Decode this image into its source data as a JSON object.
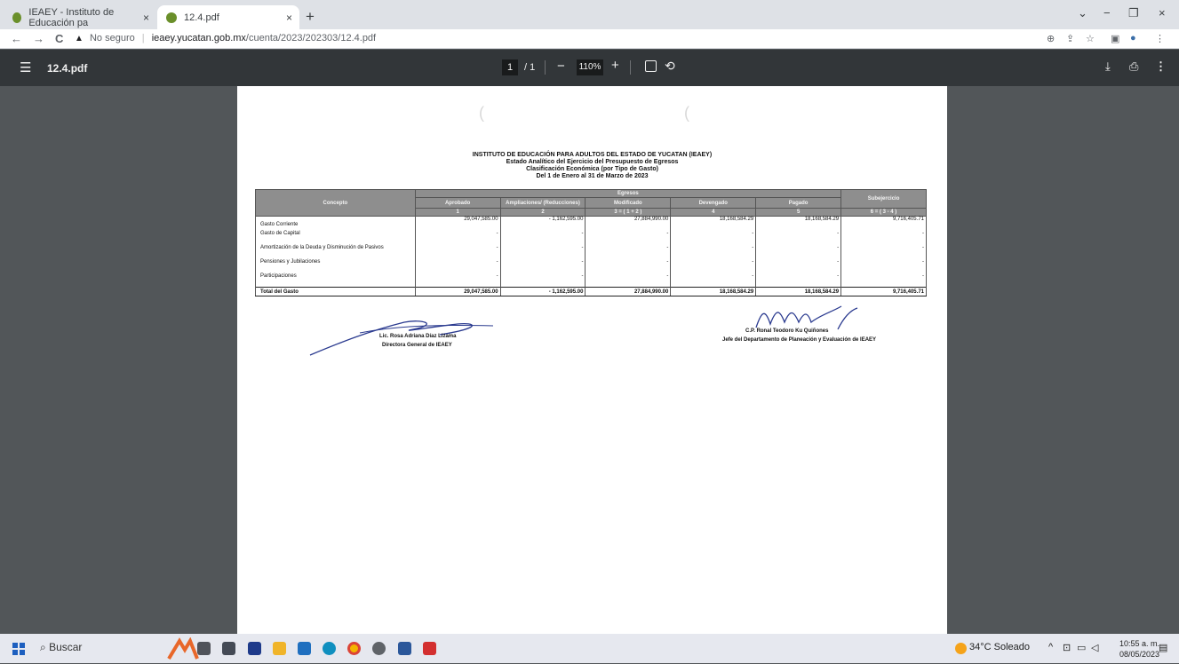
{
  "tabs": [
    {
      "title": "IEAEY - Instituto de Educación pa",
      "close": "×"
    },
    {
      "title": "12.4.pdf",
      "close": "×"
    }
  ],
  "new_tab": "+",
  "window_controls": {
    "minimize": "−",
    "restore": "❐",
    "close": "×",
    "dropdown": "⌄"
  },
  "address": {
    "back": "←",
    "forward": "→",
    "reload": "C",
    "warning": "▲",
    "security": "No seguro",
    "separator": "|",
    "domain": "ieaey.yucatan.gob.mx",
    "path": "/cuenta/2023/202303/12.4.pdf"
  },
  "address_icons": {
    "zoom": "⊕",
    "share": "⇪",
    "star": "☆",
    "sidebar": "▣",
    "profile": "●",
    "menu": "⋮"
  },
  "pdf_toolbar": {
    "menu": "☰",
    "title": "12.4.pdf",
    "page": "1",
    "total": "/ 1",
    "zoom_out": "−",
    "zoom": "110%",
    "zoom_in": "+",
    "rotate": "⟲",
    "download": "⤓",
    "print": "⎙",
    "more": "⋮"
  },
  "document": {
    "title": "INSTITUTO DE EDUCACIÓN PARA ADULTOS DEL ESTADO DE YUCATAN (IEAEY)",
    "subtitle1": "Estado Analítico del Ejercicio del Presupuesto de Egresos",
    "subtitle2": "Clasificación Económica (por Tipo de Gasto)",
    "subtitle3": "Del 1 de Enero al 31 de Marzo de 2023",
    "table": {
      "egresos_header": "Egresos",
      "headers": [
        "Concepto",
        "Aprobado",
        "Ampliaciones/ (Reducciones)",
        "Modificado",
        "Devengado",
        "Pagado",
        "Subejercicio"
      ],
      "subheaders": [
        "1",
        "2",
        "3 = ( 1 + 2 )",
        "4",
        "5",
        "6 = ( 3 - 4 )"
      ],
      "rows": [
        {
          "concepto": "Gasto Corriente",
          "values": [
            "29,047,585.00",
            "- 1,162,595.00",
            "27,884,990.00",
            "18,168,584.29",
            "18,168,584.29",
            "9,716,405.71"
          ]
        },
        {
          "concepto": "Gasto de Capital",
          "values": [
            "-",
            "-",
            "-",
            "-",
            "-",
            "-"
          ]
        },
        {
          "concepto": "Amortización de la Deuda y Disminución de Pasivos",
          "values": [
            "-",
            "-",
            "-",
            "-",
            "-",
            "-"
          ]
        },
        {
          "concepto": "Pensiones y Jubilaciones",
          "values": [
            "-",
            "-",
            "-",
            "-",
            "-",
            "-"
          ]
        },
        {
          "concepto": "Participaciones",
          "values": [
            "-",
            "-",
            "-",
            "-",
            "-",
            "-"
          ]
        }
      ],
      "total": {
        "concepto": "Total del Gasto",
        "values": [
          "29,047,585.00",
          "- 1,162,595.00",
          "27,884,990.00",
          "18,168,584.29",
          "18,168,584.29",
          "9,716,405.71"
        ]
      }
    },
    "signature_left": {
      "name": "Lic. Rosa Adriana Díaz Lizama",
      "role": "Directora General de IEAEY"
    },
    "signature_right": {
      "name": "C.P. Ronal Teodoro Ku Quiñones",
      "role": "Jefe del Departamento de Planeación y Evaluación de IEAEY"
    }
  },
  "taskbar": {
    "search_placeholder": "Buscar",
    "weather": "34°C  Soleado",
    "time": "10:55 a. m.",
    "date": "08/05/2023",
    "tray_up": "^",
    "notifications": "▤"
  }
}
